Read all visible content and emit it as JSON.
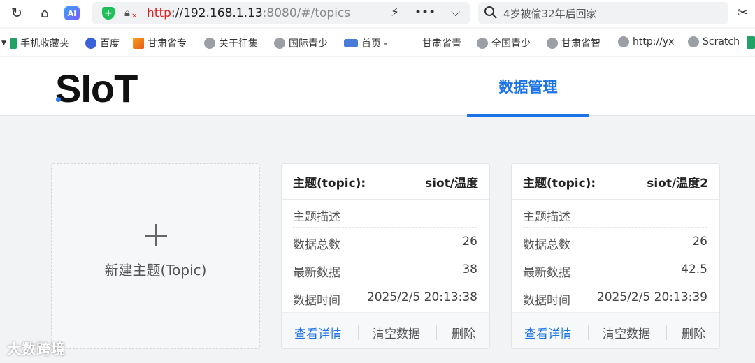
{
  "browser": {
    "url_protocol": "http",
    "url_host": "://192.168.1.13",
    "url_rest": ":8080/#/topics",
    "search_text": "4岁被偷32年后回家",
    "ai_badge": "AI"
  },
  "bookmarks": [
    {
      "label": "手机收藏夹",
      "icon": "phone-icon"
    },
    {
      "label": "百度",
      "icon": "baidu-paw-icon"
    },
    {
      "label": "甘肃省专",
      "icon": "flag-icon"
    },
    {
      "label": "关于征集",
      "icon": "globe-icon"
    },
    {
      "label": "国际青少",
      "icon": "globe-icon"
    },
    {
      "label": "首页 -",
      "icon": "eye-icon"
    },
    {
      "label": "甘肃省青",
      "icon": ""
    },
    {
      "label": "全国青少",
      "icon": "globe-icon"
    },
    {
      "label": "甘肃省智",
      "icon": "globe-icon"
    },
    {
      "label": "http://yx",
      "icon": "globe-icon"
    },
    {
      "label": "Scratch",
      "icon": "globe-icon"
    }
  ],
  "app": {
    "logo": "SIoT",
    "nav_active": "数据管理"
  },
  "new_topic": {
    "label": "新建主题(Topic)"
  },
  "topics": [
    {
      "head_label": "主题(topic):",
      "name": "siot/温度",
      "desc_label": "主题描述",
      "desc_value": "",
      "count_label": "数据总数",
      "count_value": "26",
      "latest_label": "最新数据",
      "latest_value": "38",
      "time_label": "数据时间",
      "time_value": "2025/2/5 20:13:38",
      "btn_detail": "查看详情",
      "btn_clear": "清空数据",
      "btn_delete": "删除"
    },
    {
      "head_label": "主题(topic):",
      "name": "siot/温度2",
      "desc_label": "主题描述",
      "desc_value": "",
      "count_label": "数据总数",
      "count_value": "26",
      "latest_label": "最新数据",
      "latest_value": "42.5",
      "time_label": "数据时间",
      "time_value": "2025/2/5 20:13:39",
      "btn_detail": "查看详情",
      "btn_clear": "清空数据",
      "btn_delete": "删除"
    }
  ],
  "watermark": "大数跨境",
  "colors": {
    "accent": "#1a73e8",
    "shield": "#1fbf5a"
  }
}
